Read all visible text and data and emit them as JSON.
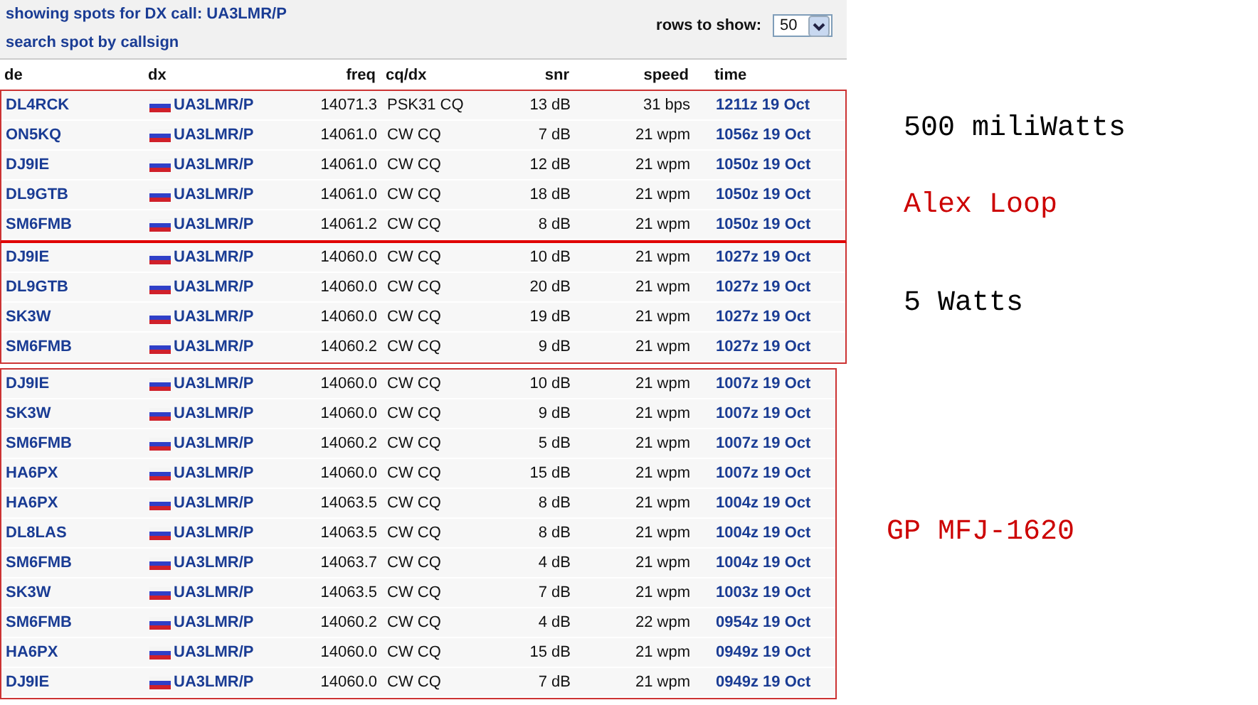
{
  "header": {
    "title": "showing spots for DX call: UA3LMR/P",
    "search_link": "search spot by callsign",
    "rows_label": "rows to show:",
    "rows_value": "50"
  },
  "columns": [
    "de",
    "dx",
    "freq",
    "cq/dx",
    "snr",
    "speed",
    "time"
  ],
  "groups": [
    {
      "notes": [
        {
          "text": "500 miliWatts",
          "color": "#000000"
        },
        {
          "text": "Alex Loop",
          "color": "#cc0000"
        }
      ],
      "rows": [
        {
          "de": "DL4RCK",
          "dx": "UA3LMR/P",
          "freq": "14071.3",
          "mode": "PSK31 CQ",
          "snr": "13 dB",
          "speed": "31 bps",
          "time": "1211z 19 Oct"
        },
        {
          "de": "ON5KQ",
          "dx": "UA3LMR/P",
          "freq": "14061.0",
          "mode": "CW CQ",
          "snr": "7 dB",
          "speed": "21 wpm",
          "time": "1056z 19 Oct"
        },
        {
          "de": "DJ9IE",
          "dx": "UA3LMR/P",
          "freq": "14061.0",
          "mode": "CW CQ",
          "snr": "12 dB",
          "speed": "21 wpm",
          "time": "1050z 19 Oct"
        },
        {
          "de": "DL9GTB",
          "dx": "UA3LMR/P",
          "freq": "14061.0",
          "mode": "CW CQ",
          "snr": "18 dB",
          "speed": "21 wpm",
          "time": "1050z 19 Oct"
        },
        {
          "de": "SM6FMB",
          "dx": "UA3LMR/P",
          "freq": "14061.2",
          "mode": "CW CQ",
          "snr": "8 dB",
          "speed": "21 wpm",
          "time": "1050z 19 Oct"
        }
      ]
    },
    {
      "notes": [
        {
          "text": "5 Watts",
          "color": "#000000"
        }
      ],
      "rows": [
        {
          "de": "DJ9IE",
          "dx": "UA3LMR/P",
          "freq": "14060.0",
          "mode": "CW CQ",
          "snr": "10 dB",
          "speed": "21 wpm",
          "time": "1027z 19 Oct"
        },
        {
          "de": "DL9GTB",
          "dx": "UA3LMR/P",
          "freq": "14060.0",
          "mode": "CW CQ",
          "snr": "20 dB",
          "speed": "21 wpm",
          "time": "1027z 19 Oct"
        },
        {
          "de": "SK3W",
          "dx": "UA3LMR/P",
          "freq": "14060.0",
          "mode": "CW CQ",
          "snr": "19 dB",
          "speed": "21 wpm",
          "time": "1027z 19 Oct"
        },
        {
          "de": "SM6FMB",
          "dx": "UA3LMR/P",
          "freq": "14060.2",
          "mode": "CW CQ",
          "snr": "9 dB",
          "speed": "21 wpm",
          "time": "1027z 19 Oct"
        }
      ]
    },
    {
      "notes": [
        {
          "text": "GP MFJ-1620",
          "color": "#cc0000"
        }
      ],
      "rows": [
        {
          "de": "DJ9IE",
          "dx": "UA3LMR/P",
          "freq": "14060.0",
          "mode": "CW CQ",
          "snr": "10 dB",
          "speed": "21 wpm",
          "time": "1007z 19 Oct"
        },
        {
          "de": "SK3W",
          "dx": "UA3LMR/P",
          "freq": "14060.0",
          "mode": "CW CQ",
          "snr": "9 dB",
          "speed": "21 wpm",
          "time": "1007z 19 Oct"
        },
        {
          "de": "SM6FMB",
          "dx": "UA3LMR/P",
          "freq": "14060.2",
          "mode": "CW CQ",
          "snr": "5 dB",
          "speed": "21 wpm",
          "time": "1007z 19 Oct"
        },
        {
          "de": "HA6PX",
          "dx": "UA3LMR/P",
          "freq": "14060.0",
          "mode": "CW CQ",
          "snr": "15 dB",
          "speed": "21 wpm",
          "time": "1007z 19 Oct"
        },
        {
          "de": "HA6PX",
          "dx": "UA3LMR/P",
          "freq": "14063.5",
          "mode": "CW CQ",
          "snr": "8 dB",
          "speed": "21 wpm",
          "time": "1004z 19 Oct"
        },
        {
          "de": "DL8LAS",
          "dx": "UA3LMR/P",
          "freq": "14063.5",
          "mode": "CW CQ",
          "snr": "8 dB",
          "speed": "21 wpm",
          "time": "1004z 19 Oct"
        },
        {
          "de": "SM6FMB",
          "dx": "UA3LMR/P",
          "freq": "14063.7",
          "mode": "CW CQ",
          "snr": "4 dB",
          "speed": "21 wpm",
          "time": "1004z 19 Oct"
        },
        {
          "de": "SK3W",
          "dx": "UA3LMR/P",
          "freq": "14063.5",
          "mode": "CW CQ",
          "snr": "7 dB",
          "speed": "21 wpm",
          "time": "1003z 19 Oct"
        },
        {
          "de": "SM6FMB",
          "dx": "UA3LMR/P",
          "freq": "14060.2",
          "mode": "CW CQ",
          "snr": "4 dB",
          "speed": "22 wpm",
          "time": "0954z 19 Oct"
        },
        {
          "de": "HA6PX",
          "dx": "UA3LMR/P",
          "freq": "14060.0",
          "mode": "CW CQ",
          "snr": "15 dB",
          "speed": "21 wpm",
          "time": "0949z 19 Oct"
        },
        {
          "de": "DJ9IE",
          "dx": "UA3LMR/P",
          "freq": "14060.0",
          "mode": "CW CQ",
          "snr": "7 dB",
          "speed": "21 wpm",
          "time": "0949z 19 Oct"
        }
      ]
    }
  ]
}
